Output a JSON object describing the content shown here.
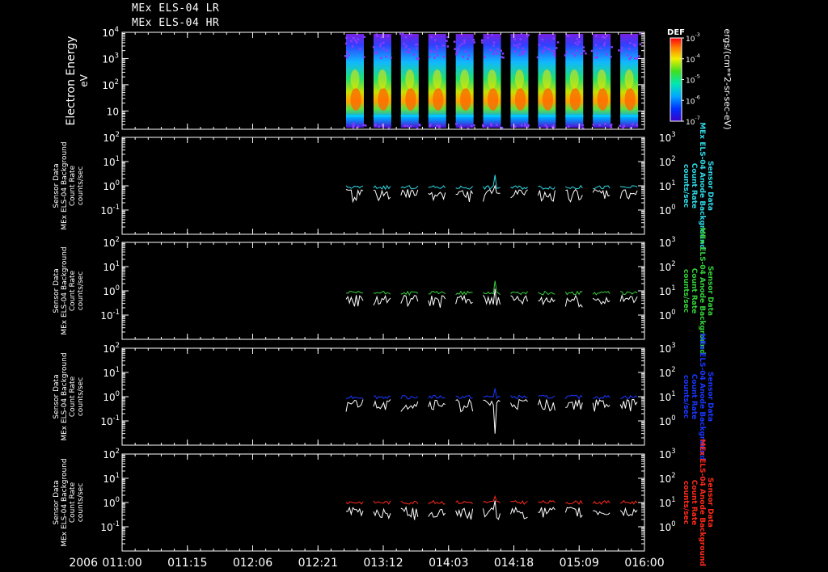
{
  "header": {
    "title_lr": "MEx ELS-04 LR",
    "title_hr": "MEx ELS-04 HR"
  },
  "x_axis": {
    "year": "2006",
    "ticks": [
      "011:00",
      "011:15",
      "012:06",
      "012:21",
      "013:12",
      "014:03",
      "014:18",
      "015:09",
      "016:00"
    ]
  },
  "colors": {
    "background": "#000000",
    "axes": "#ffffff",
    "panel1_series": "#2fd8e6",
    "panel2_series": "#35d03a",
    "panel3_series": "#1a36ff",
    "panel4_series": "#ff2a1a",
    "white_series": "#ffffff"
  },
  "chart_data": [
    {
      "type": "heatmap",
      "ylabel": "Electron Energy",
      "yunit": "eV",
      "yscale": "log",
      "ylim": [
        2,
        10000
      ],
      "yticks": [
        {
          "v": 10000,
          "m": "10",
          "e": "4"
        },
        {
          "v": 1000,
          "m": "10",
          "e": "3"
        },
        {
          "v": 100,
          "m": "10",
          "e": "2"
        },
        {
          "v": 10,
          "m": "10",
          "e": ""
        }
      ],
      "colorbar": {
        "label": "DEF",
        "unit": "ergs/(cm**2-sr-sec-eV)",
        "scale": "log",
        "range": [
          1e-07,
          0.001
        ],
        "ticks": [
          {
            "v": 0.001,
            "m": "10",
            "e": "-3"
          },
          {
            "v": 0.0001,
            "m": "10",
            "e": "-4"
          },
          {
            "v": 1e-05,
            "m": "10",
            "e": "-5"
          },
          {
            "v": 1e-06,
            "m": "10",
            "e": "-6"
          },
          {
            "v": 1e-07,
            "m": "10",
            "e": "-7"
          }
        ]
      },
      "data_blocks_x": [
        0.59,
        0.64,
        0.69,
        0.745,
        0.8,
        0.855,
        0.905,
        0.955,
        1.005,
        1.06,
        1.11
      ],
      "data_block_width": 0.03
    },
    {
      "type": "line",
      "left_label": [
        "Sensor Data",
        "MEx ELS-04 Background",
        "Count Rate",
        "counts/sec"
      ],
      "right_label": [
        "Sensor Data",
        "MEx ELS-04 Anode Background",
        "Count Rate",
        "counts/sec"
      ],
      "yscale": "log",
      "ylim_left": [
        0.01,
        100
      ],
      "ylim_right": [
        0.1,
        1000
      ],
      "yticks_left": [
        {
          "v": 100,
          "m": "10",
          "e": "2"
        },
        {
          "v": 10,
          "m": "10",
          "e": "1"
        },
        {
          "v": 1,
          "m": "10",
          "e": "0"
        },
        {
          "v": 0.1,
          "m": "10",
          "e": "-1"
        }
      ],
      "yticks_right": [
        {
          "v": 1000,
          "m": "10",
          "e": "3"
        },
        {
          "v": 100,
          "m": "10",
          "e": "2"
        },
        {
          "v": 10,
          "m": "10",
          "e": "1"
        },
        {
          "v": 1,
          "m": "10",
          "e": "0"
        }
      ],
      "series": [
        {
          "color_key": "panel1_series",
          "level": 0.85,
          "spike": 2.8
        },
        {
          "color_key": "white_series",
          "level": 0.42,
          "spike": 1.0
        }
      ]
    },
    {
      "type": "line",
      "left_label": [
        "Sensor Data",
        "MEx ELS-04 Background",
        "Count Rate",
        "counts/sec"
      ],
      "right_label": [
        "Sensor Data",
        "MEx ELS-04 Anode Background",
        "Count Rate",
        "counts/sec"
      ],
      "yscale": "log",
      "ylim_left": [
        0.01,
        100
      ],
      "ylim_right": [
        0.1,
        1000
      ],
      "yticks_left": [
        {
          "v": 100,
          "m": "10",
          "e": "2"
        },
        {
          "v": 10,
          "m": "10",
          "e": "1"
        },
        {
          "v": 1,
          "m": "10",
          "e": "0"
        },
        {
          "v": 0.1,
          "m": "10",
          "e": "-1"
        }
      ],
      "yticks_right": [
        {
          "v": 1000,
          "m": "10",
          "e": "3"
        },
        {
          "v": 100,
          "m": "10",
          "e": "2"
        },
        {
          "v": 10,
          "m": "10",
          "e": "1"
        },
        {
          "v": 1,
          "m": "10",
          "e": "0"
        }
      ],
      "series": [
        {
          "color_key": "panel2_series",
          "level": 0.8,
          "spike": 2.6
        },
        {
          "color_key": "white_series",
          "level": 0.4,
          "spike": 1.2
        }
      ]
    },
    {
      "type": "line",
      "left_label": [
        "Sensor Data",
        "MEx ELS-04 Background",
        "Count Rate",
        "counts/sec"
      ],
      "right_label": [
        "Sensor Data",
        "MEx ELS-04 Anode Background",
        "Count Rate",
        "counts/sec"
      ],
      "yscale": "log",
      "ylim_left": [
        0.01,
        100
      ],
      "ylim_right": [
        0.1,
        1000
      ],
      "yticks_left": [
        {
          "v": 100,
          "m": "10",
          "e": "2"
        },
        {
          "v": 10,
          "m": "10",
          "e": "1"
        },
        {
          "v": 1,
          "m": "10",
          "e": "0"
        },
        {
          "v": 0.1,
          "m": "10",
          "e": "-1"
        }
      ],
      "yticks_right": [
        {
          "v": 1000,
          "m": "10",
          "e": "3"
        },
        {
          "v": 100,
          "m": "10",
          "e": "2"
        },
        {
          "v": 10,
          "m": "10",
          "e": "1"
        },
        {
          "v": 1,
          "m": "10",
          "e": "0"
        }
      ],
      "series": [
        {
          "color_key": "panel3_series",
          "level": 0.95,
          "spike": 2.2
        },
        {
          "color_key": "white_series",
          "level": 0.45,
          "spike": 0.03
        }
      ]
    },
    {
      "type": "line",
      "left_label": [
        "Sensor Data",
        "MEx ELS-04 Background",
        "Count Rate",
        "counts/sec"
      ],
      "right_label": [
        "Sensor Data",
        "MEx ELS-04 Anode Background",
        "Count Rate",
        "counts/sec"
      ],
      "yscale": "log",
      "ylim_left": [
        0.01,
        100
      ],
      "ylim_right": [
        0.1,
        1000
      ],
      "yticks_left": [
        {
          "v": 100,
          "m": "10",
          "e": "2"
        },
        {
          "v": 10,
          "m": "10",
          "e": "1"
        },
        {
          "v": 1,
          "m": "10",
          "e": "0"
        },
        {
          "v": 0.1,
          "m": "10",
          "e": "-1"
        }
      ],
      "yticks_right": [
        {
          "v": 1000,
          "m": "10",
          "e": "3"
        },
        {
          "v": 100,
          "m": "10",
          "e": "2"
        },
        {
          "v": 10,
          "m": "10",
          "e": "1"
        },
        {
          "v": 1,
          "m": "10",
          "e": "0"
        }
      ],
      "series": [
        {
          "color_key": "panel4_series",
          "level": 1.0,
          "spike": 1.8
        },
        {
          "color_key": "white_series",
          "level": 0.38,
          "spike": 1.2
        }
      ]
    }
  ]
}
